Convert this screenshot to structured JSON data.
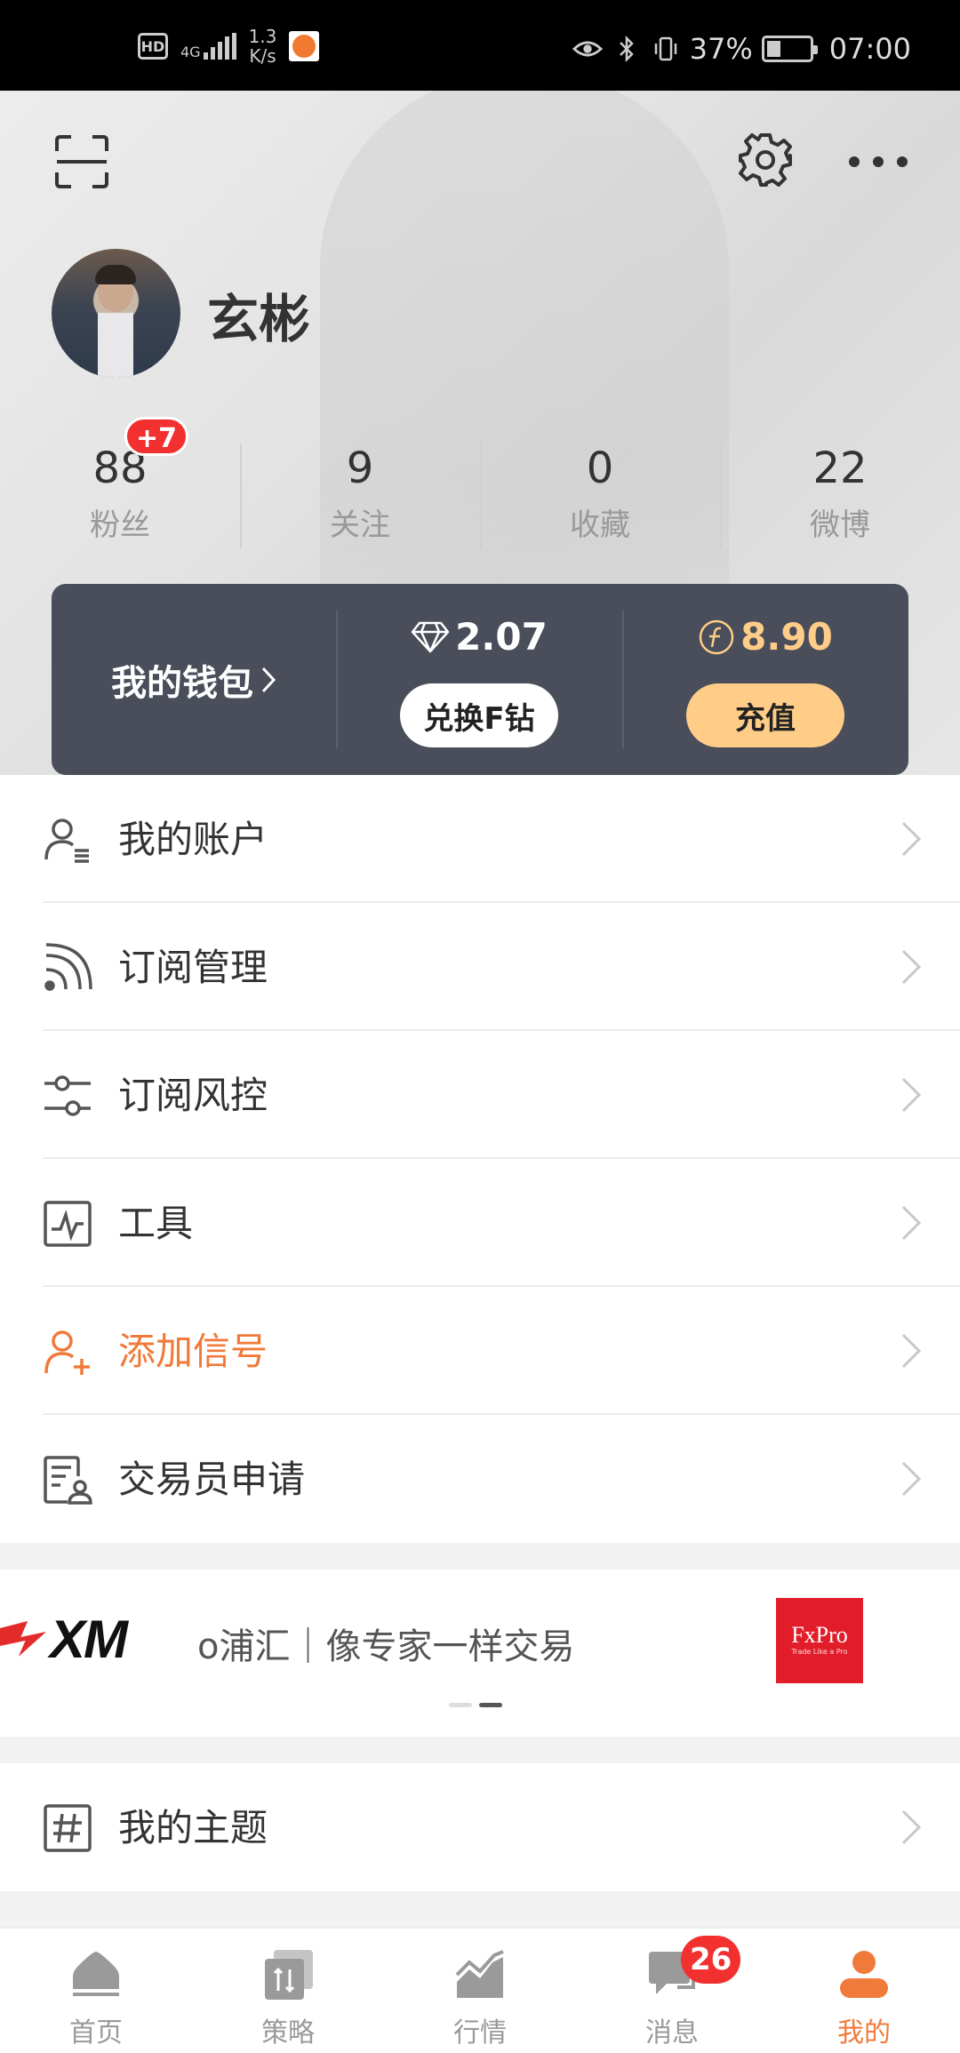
{
  "status_bar": {
    "hd": "HD",
    "network": "4G",
    "speed_value": "1.3",
    "speed_unit": "K/s",
    "battery": "37%",
    "time": "07:00"
  },
  "profile": {
    "username": "玄彬",
    "stats": [
      {
        "value": "88",
        "label": "粉丝",
        "badge": "+7"
      },
      {
        "value": "9",
        "label": "关注"
      },
      {
        "value": "0",
        "label": "收藏"
      },
      {
        "value": "22",
        "label": "微博"
      }
    ]
  },
  "wallet": {
    "title": "我的钱包",
    "diamond_value": "2.07",
    "diamond_button": "兑换F钻",
    "coin_value": "8.90",
    "coin_button": "充值"
  },
  "menu": [
    {
      "label": "我的账户",
      "icon": "account-icon"
    },
    {
      "label": "订阅管理",
      "icon": "rss-icon"
    },
    {
      "label": "订阅风控",
      "icon": "sliders-icon"
    },
    {
      "label": "工具",
      "icon": "chart-tool-icon"
    },
    {
      "label": "添加信号",
      "icon": "add-user-icon"
    },
    {
      "label": "交易员申请",
      "icon": "trader-apply-icon"
    }
  ],
  "banner": {
    "brand_left": "XM",
    "text": "o浦汇｜像专家一样交易",
    "brand_right": "FxPro",
    "brand_right_sub": "Trade Like a Pro"
  },
  "menu2": [
    {
      "label": "我的主题",
      "icon": "hashtag-icon"
    }
  ],
  "tabs": [
    {
      "label": "首页",
      "icon": "home-icon"
    },
    {
      "label": "策略",
      "icon": "strategy-icon"
    },
    {
      "label": "行情",
      "icon": "market-icon"
    },
    {
      "label": "消息",
      "icon": "message-icon",
      "badge": "26"
    },
    {
      "label": "我的",
      "icon": "profile-icon",
      "active": true
    }
  ],
  "colors": {
    "accent": "#f07a3a",
    "wallet_bg": "#494e5a",
    "badge": "#f23030",
    "recharge_button": "#ffcd87"
  }
}
